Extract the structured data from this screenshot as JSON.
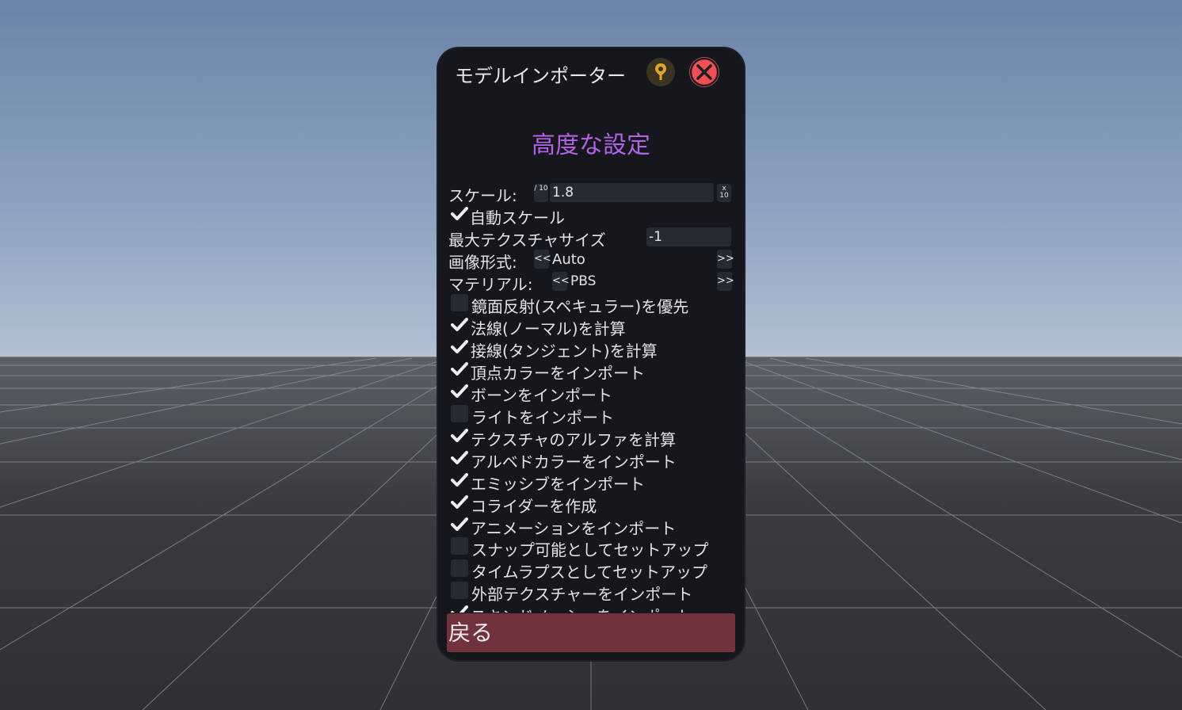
{
  "window": {
    "title": "モデルインポーター",
    "pin_icon": "pin-icon",
    "close_icon": "close-icon",
    "accent_heading": "#b264e6",
    "close_color": "#f04f55"
  },
  "heading": "高度な設定",
  "scale": {
    "label": "スケール:",
    "divide_btn": "/ 10",
    "value": "1.8",
    "multiply_btn": "x 10"
  },
  "auto_scale": {
    "label": "自動スケール",
    "checked": true
  },
  "max_texture": {
    "label": "最大テクスチャサイズ",
    "value": "-1"
  },
  "image_format": {
    "label": "画像形式:",
    "prev": "<<",
    "value": "Auto",
    "next": ">>"
  },
  "material": {
    "label": "マテリアル:",
    "prev": "<<",
    "value": "PBS",
    "next": ">>"
  },
  "options": [
    {
      "label": "鏡面反射(スペキュラー)を優先",
      "checked": false
    },
    {
      "label": "法線(ノーマル)を計算",
      "checked": true
    },
    {
      "label": "接線(タンジェント)を計算",
      "checked": true
    },
    {
      "label": "頂点カラーをインポート",
      "checked": true
    },
    {
      "label": "ボーンをインポート",
      "checked": true
    },
    {
      "label": "ライトをインポート",
      "checked": false
    },
    {
      "label": "テクスチャのアルファを計算",
      "checked": true
    },
    {
      "label": "アルベドカラーをインポート",
      "checked": true
    },
    {
      "label": "エミッシブをインポート",
      "checked": true
    },
    {
      "label": "コライダーを作成",
      "checked": true
    },
    {
      "label": "アニメーションをインポート",
      "checked": true
    },
    {
      "label": "スナップ可能としてセットアップ",
      "checked": false
    },
    {
      "label": "タイムラプスとしてセットアップ",
      "checked": false
    },
    {
      "label": "外部テクスチャーをインポート",
      "checked": false
    },
    {
      "label": "スキンドメッシュをインポート",
      "checked": true
    }
  ],
  "back_button": "戻る",
  "back_color": "#71333b"
}
